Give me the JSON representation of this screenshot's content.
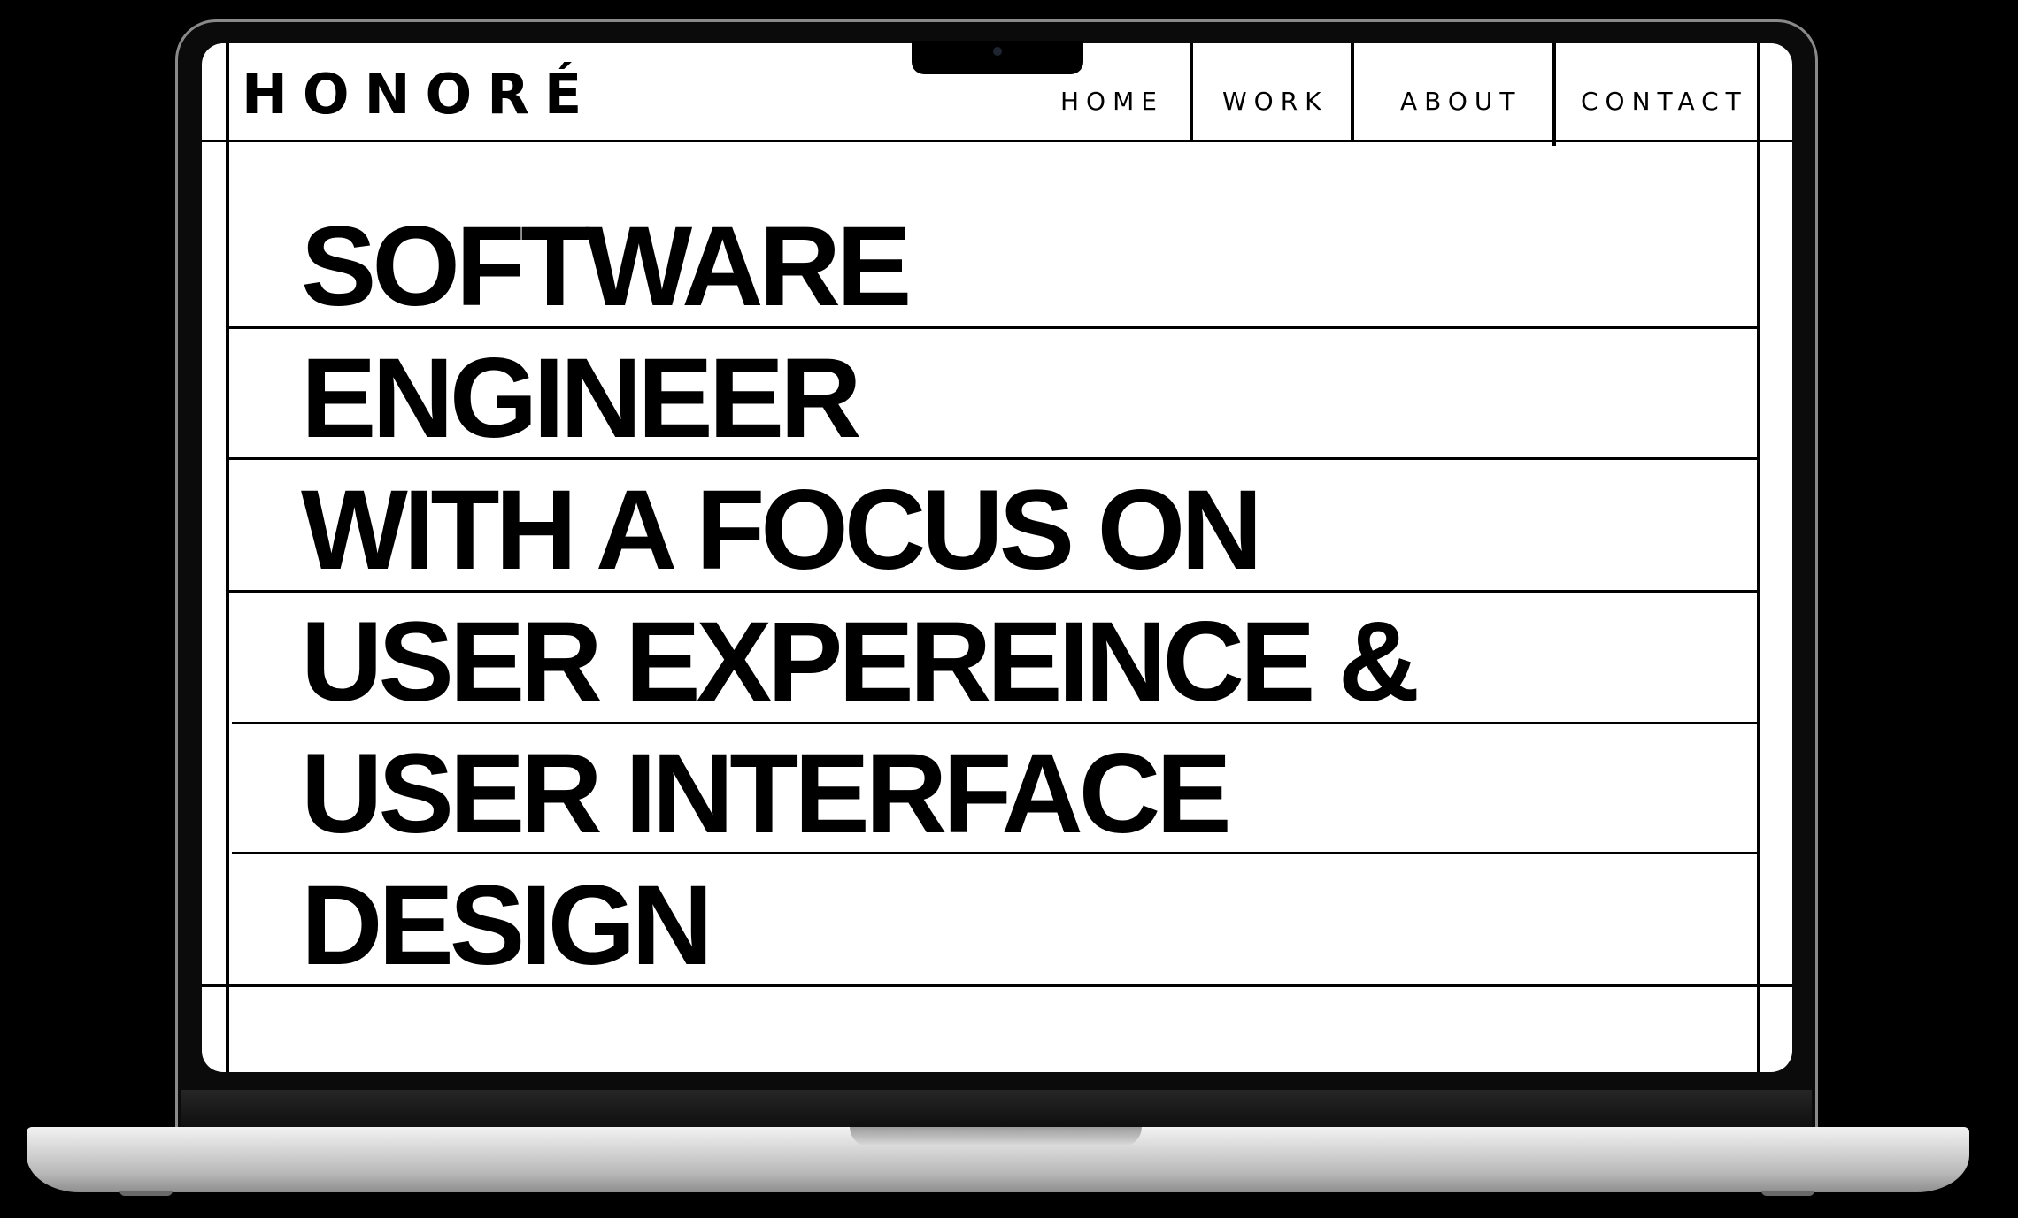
{
  "site": {
    "logo": "HONORÉ"
  },
  "nav": {
    "items": [
      {
        "label": "HOME"
      },
      {
        "label": "WORK"
      },
      {
        "label": "ABOUT"
      },
      {
        "label": "CONTACT"
      }
    ]
  },
  "hero": {
    "lines": [
      "SOFTWARE",
      "ENGINEER",
      "WITH A FOCUS ON",
      "USER EXPEREINCE &",
      "USER INTERFACE",
      "DESIGN"
    ]
  },
  "colors": {
    "background": "#000000",
    "screen": "#ffffff",
    "ink": "#000000",
    "aluminum": "#c9c9c9"
  }
}
